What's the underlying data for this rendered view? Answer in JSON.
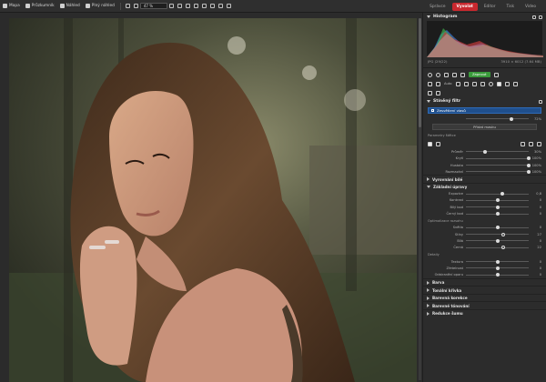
{
  "topbar": {
    "items": [
      {
        "label": "Mapa",
        "icon": "map-icon"
      },
      {
        "label": "Průzkumník",
        "icon": "folder-icon"
      },
      {
        "label": "Náhled",
        "icon": "preview-icon"
      },
      {
        "label": "Plný náhled",
        "icon": "fullscreen-icon"
      }
    ],
    "zoom": "47 %",
    "tabs": [
      {
        "label": "Správce",
        "active": false
      },
      {
        "label": "Vyvolat",
        "active": true
      },
      {
        "label": "Editor",
        "active": false
      },
      {
        "label": "Tisk",
        "active": false
      },
      {
        "label": "Video",
        "active": false
      }
    ]
  },
  "histogram": {
    "title": "Histogram",
    "format": "JPG",
    "count": "(29/22)",
    "dimensions": "3910 × 6012 (7.64 MB)"
  },
  "toolbar": {
    "green_button": "Zapnout",
    "auto_label": "Auto"
  },
  "filters": {
    "title": "Stíněný filtr",
    "active_item": "Zesvětlení vlasů",
    "opacity_value": "72%",
    "opacity_pos": 0.72,
    "add_mask_button": "Přidat masku",
    "params_label": "Parametry štětce",
    "sliders": [
      {
        "label": "Průměr",
        "value": "30%",
        "pos": 0.3
      },
      {
        "label": "Krytí",
        "value": "100%",
        "pos": 1.0
      },
      {
        "label": "Hustota",
        "value": "100%",
        "pos": 1.0
      },
      {
        "label": "Rozmazání",
        "value": "100%",
        "pos": 1.0
      }
    ]
  },
  "sections": {
    "expose": "Vyrovnání bílé",
    "basic": "Základní úpravy",
    "basic_sliders": [
      {
        "label": "Expozice",
        "value": "0,8",
        "pos": 0.58
      },
      {
        "label": "Kontrast",
        "value": "0",
        "pos": 0.5
      },
      {
        "label": "Bílý bod",
        "value": "0",
        "pos": 0.5
      },
      {
        "label": "Černý bod",
        "value": "0",
        "pos": 0.5
      }
    ],
    "optimize_label": "Optimalizace rozsahu",
    "optimize_sliders": [
      {
        "label": "Světla",
        "value": "0",
        "pos": 0.5
      },
      {
        "label": "Stíny",
        "value": "27",
        "pos": 0.6
      },
      {
        "label": "Bílá",
        "value": "0",
        "pos": 0.5
      },
      {
        "label": "Černá",
        "value": "22",
        "pos": 0.6
      }
    ],
    "detail_label": "Detaily",
    "detail_sliders": [
      {
        "label": "Textura",
        "value": "0",
        "pos": 0.5
      },
      {
        "label": "Zřetelnost",
        "value": "0",
        "pos": 0.5
      },
      {
        "label": "Odstranění oparu",
        "value": "0",
        "pos": 0.5
      }
    ],
    "collapsed": [
      "Barva",
      "Tonální křivka",
      "Barevná korekce",
      "Barevné tónování",
      "Redukce šumu"
    ]
  },
  "colors": {
    "accent": "#c8282e",
    "selection": "#1f4f8c",
    "green": "#3a9b3b"
  }
}
